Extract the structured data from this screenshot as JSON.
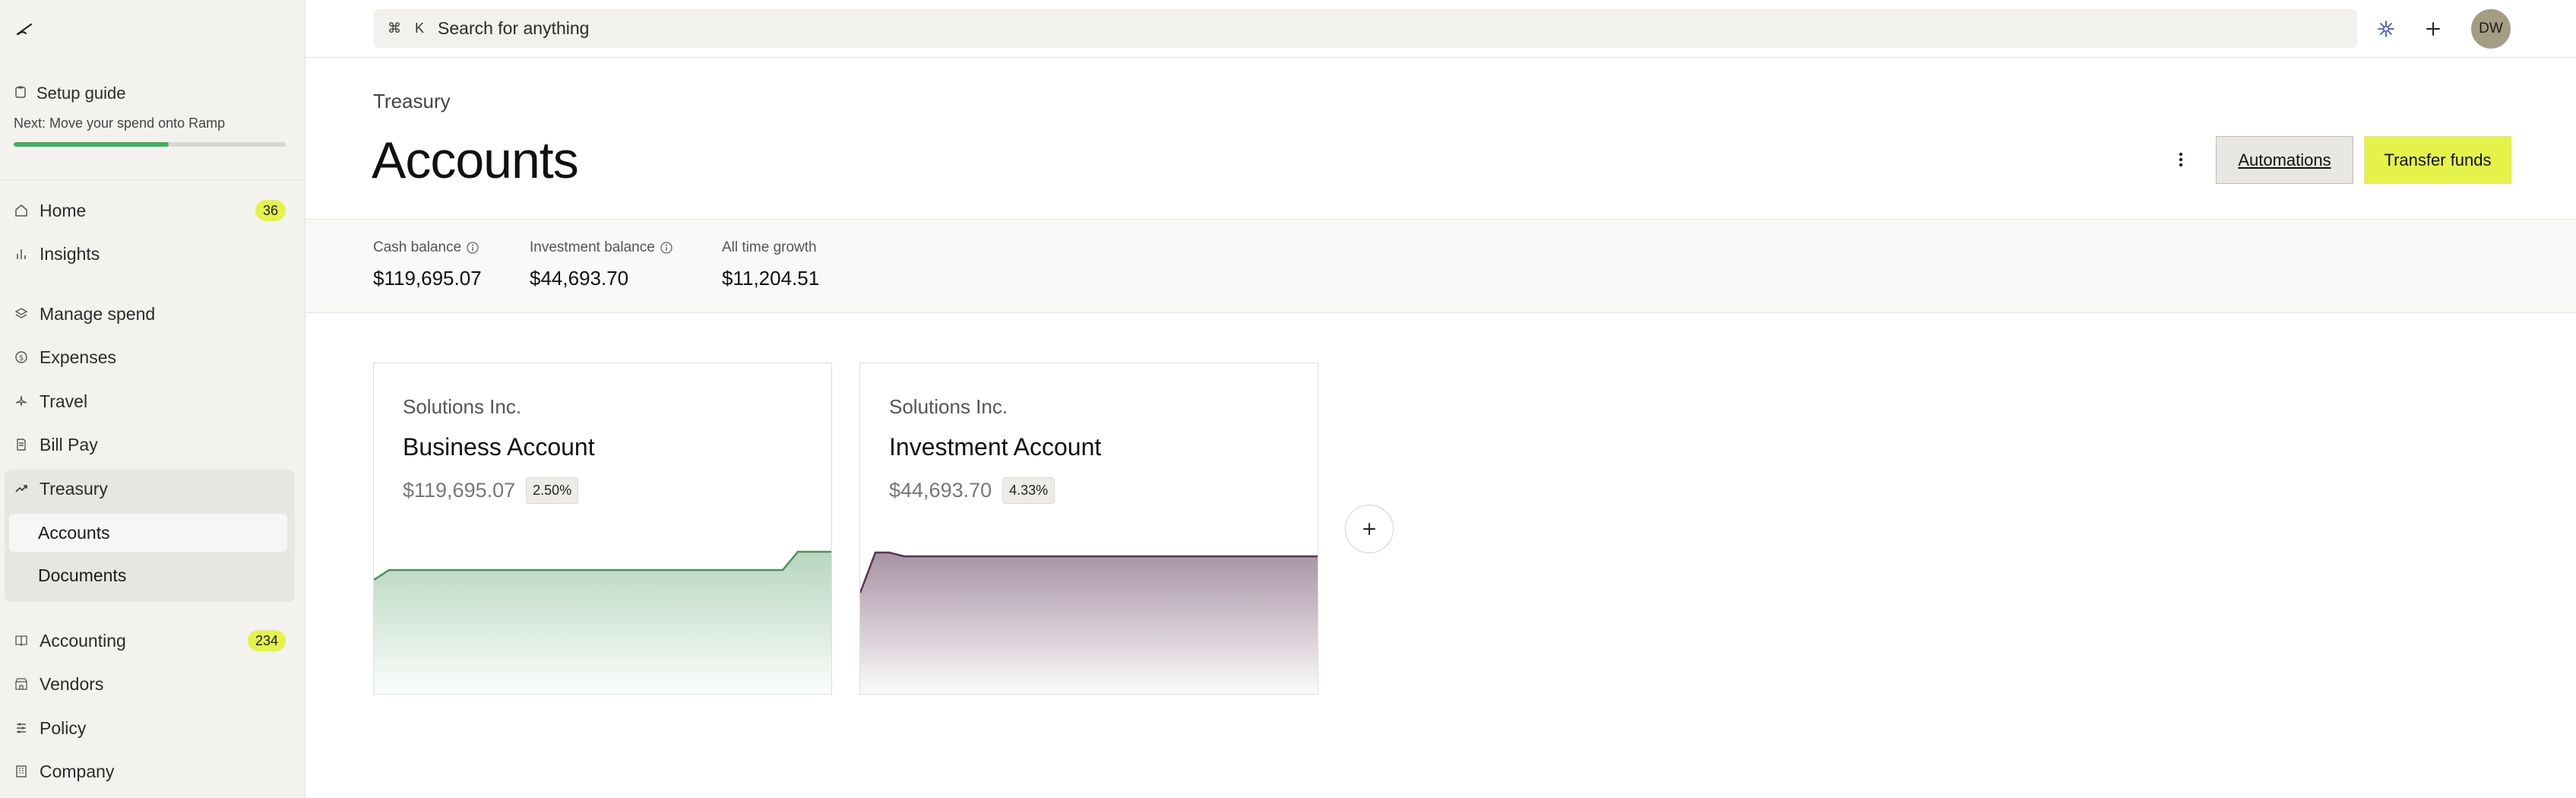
{
  "sidebar": {
    "logo_icon": "ramp-logo-icon",
    "setup": {
      "label": "Setup guide",
      "next": "Next: Move your spend onto Ramp",
      "progress": 0.57
    },
    "items": [
      {
        "label": "Home",
        "icon": "home-icon",
        "badge": "36"
      },
      {
        "label": "Insights",
        "icon": "bar-chart-icon"
      },
      {
        "label": "Manage spend",
        "icon": "layers-icon"
      },
      {
        "label": "Expenses",
        "icon": "dollar-circle-icon"
      },
      {
        "label": "Travel",
        "icon": "plane-icon"
      },
      {
        "label": "Bill Pay",
        "icon": "bill-icon"
      },
      {
        "label": "Treasury",
        "icon": "trend-up-icon"
      },
      {
        "label": "Accounting",
        "icon": "book-icon",
        "badge": "234"
      },
      {
        "label": "Vendors",
        "icon": "store-icon"
      },
      {
        "label": "Policy",
        "icon": "policy-icon"
      },
      {
        "label": "Company",
        "icon": "building-icon"
      }
    ],
    "treasury_sub": [
      {
        "label": "Accounts",
        "active": true
      },
      {
        "label": "Documents"
      }
    ]
  },
  "topbar": {
    "search_shortcut_cmd": "⌘",
    "search_shortcut_key": "K",
    "search_placeholder": "Search for anything",
    "avatar_initials": "DW"
  },
  "header": {
    "breadcrumb": "Treasury",
    "title": "Accounts",
    "automations_label": "Automations",
    "transfer_label": "Transfer funds"
  },
  "balances": [
    {
      "label": "Cash balance",
      "value": "$119,695.07",
      "info": true
    },
    {
      "label": "Investment balance",
      "value": "$44,693.70",
      "info": true
    },
    {
      "label": "All time growth",
      "value": "$11,204.51",
      "info": false
    }
  ],
  "accounts": [
    {
      "org": "Solutions Inc.",
      "name": "Business Account",
      "amount": "$119,695.07",
      "rate": "2.50%",
      "color": "#4e8f5e"
    },
    {
      "org": "Solutions Inc.",
      "name": "Investment Account",
      "amount": "$44,693.70",
      "rate": "4.33%",
      "color": "#5a3550"
    }
  ],
  "colors": {
    "accent": "#e4f24a",
    "progress": "#3cb05e"
  }
}
